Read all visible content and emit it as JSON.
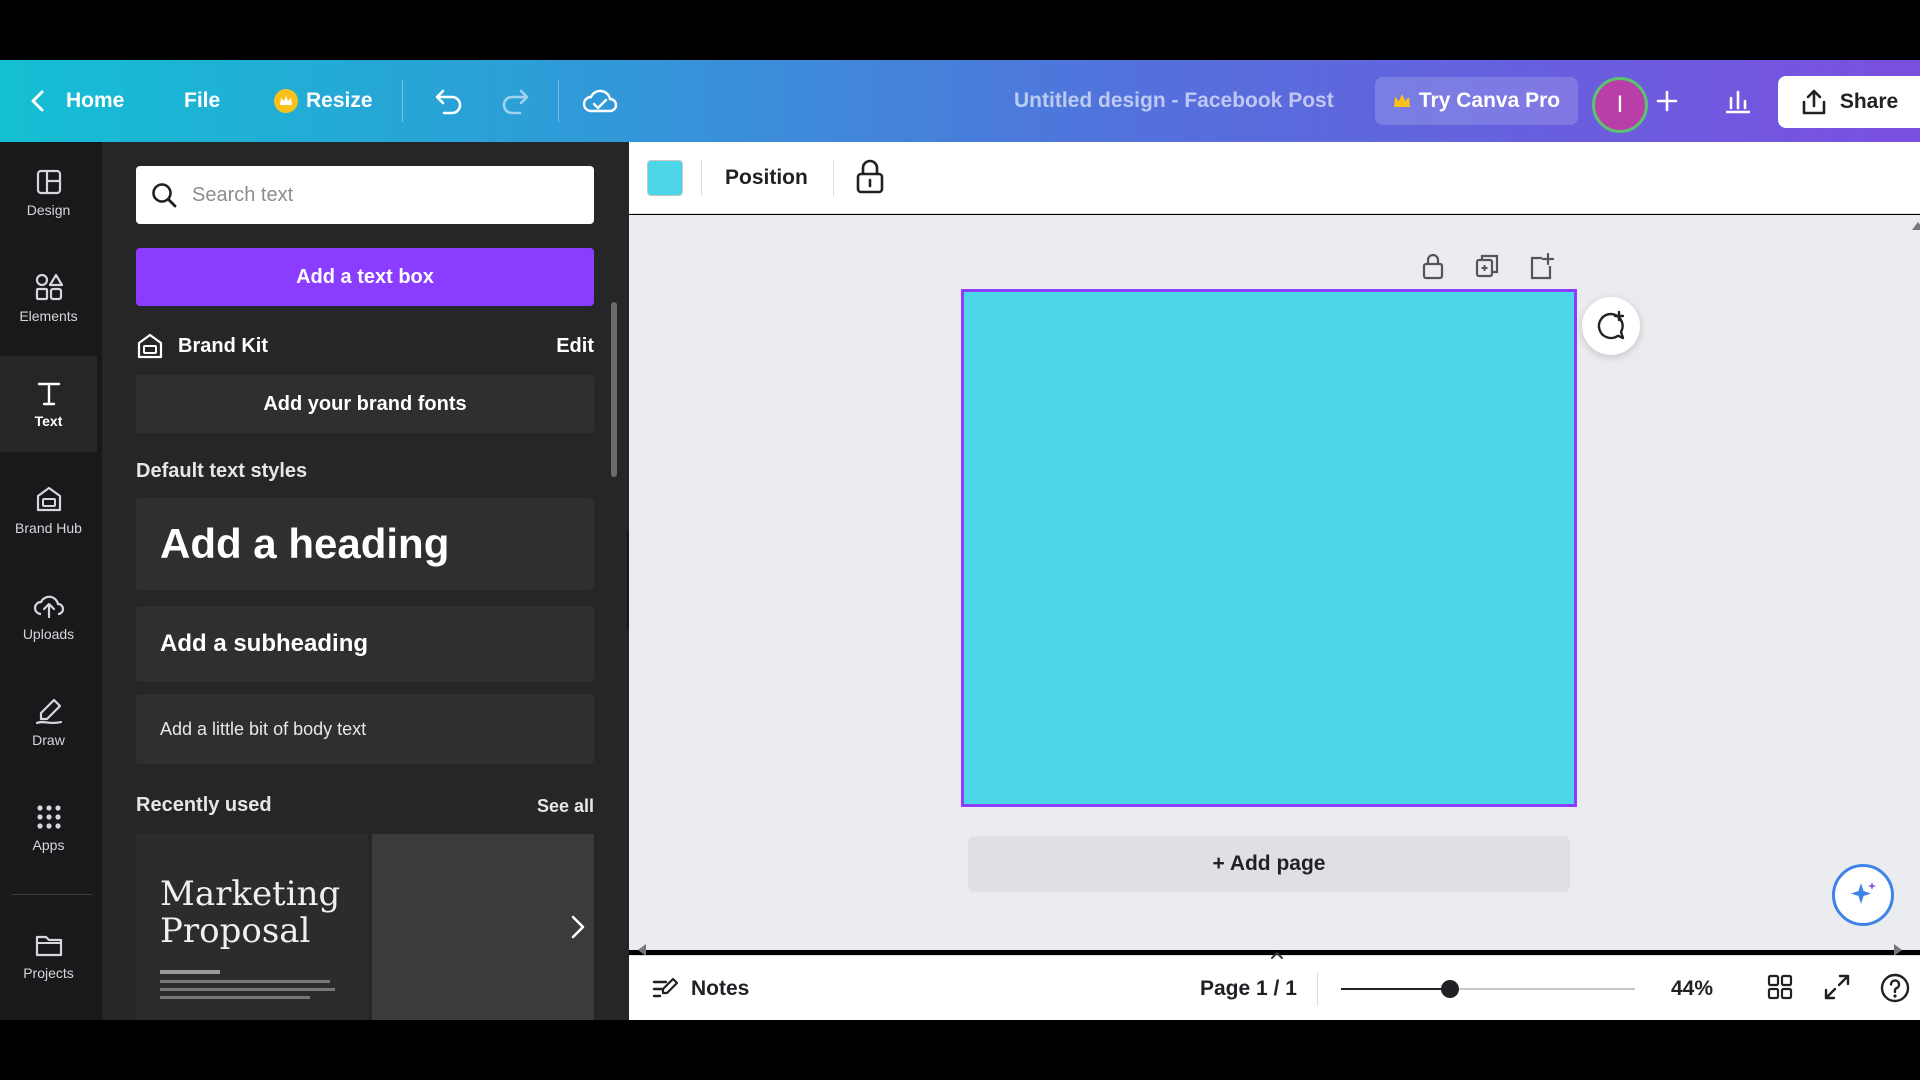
{
  "topbar": {
    "home": "Home",
    "file": "File",
    "resize": "Resize",
    "doc_title": "Untitled design - Facebook Post",
    "try_pro": "Try Canva Pro",
    "avatar_initial": "I",
    "share": "Share"
  },
  "rail": {
    "items": [
      {
        "label": "Design",
        "icon": "layout-icon"
      },
      {
        "label": "Elements",
        "icon": "shapes-icon"
      },
      {
        "label": "Text",
        "icon": "text-icon",
        "active": true
      },
      {
        "label": "Brand Hub",
        "icon": "brand-hub-icon"
      },
      {
        "label": "Uploads",
        "icon": "cloud-upload-icon"
      },
      {
        "label": "Draw",
        "icon": "pen-icon"
      },
      {
        "label": "Apps",
        "icon": "grid-dots-icon"
      },
      {
        "label": "Projects",
        "icon": "folder-icon"
      }
    ]
  },
  "panel": {
    "search_placeholder": "Search text",
    "add_text_box": "Add a text box",
    "brand_kit_title": "Brand Kit",
    "brand_kit_edit": "Edit",
    "add_brand_fonts": "Add your brand fonts",
    "default_styles_title": "Default text styles",
    "heading": "Add a heading",
    "subheading": "Add a subheading",
    "body": "Add a little bit of body text",
    "recently_used": "Recently used",
    "see_all": "See all",
    "recent_thumb_title": "Marketing Proposal"
  },
  "context_bar": {
    "swatch_color": "#4dd6e8",
    "position": "Position"
  },
  "canvas": {
    "page_color": "#4dd6e8",
    "add_page": "+ Add page"
  },
  "bottombar": {
    "notes": "Notes",
    "page_info": "Page 1 / 1",
    "zoom_label": "44%",
    "zoom_level": 0.37
  },
  "colors": {
    "accent_purple": "#8b3dff",
    "panel_bg": "#252627",
    "rail_bg": "#18191b"
  }
}
